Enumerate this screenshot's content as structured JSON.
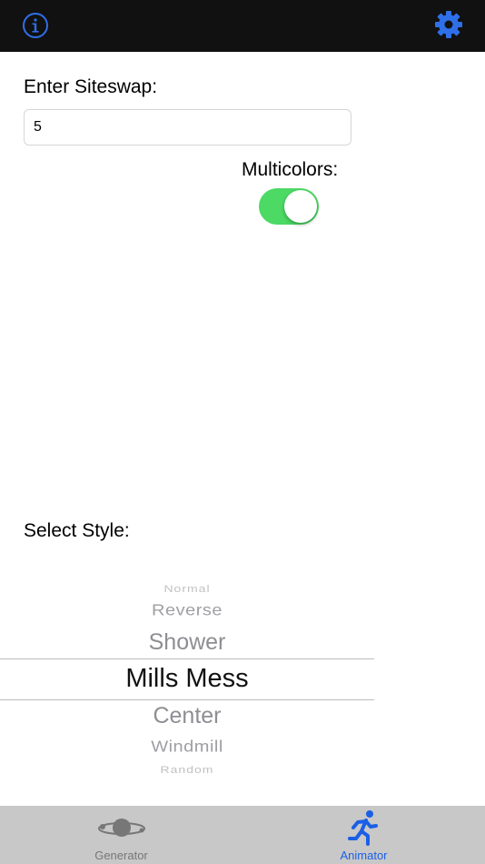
{
  "header": {
    "info_icon": "info-circle-icon",
    "settings_icon": "gear-icon",
    "accent_color": "#2f6fe8"
  },
  "form": {
    "siteswap_label": "Enter Siteswap:",
    "siteswap_value": "5",
    "multicolor_label": "Multicolors:",
    "multicolor_on": true,
    "toggle_color": "#4cd964"
  },
  "style_picker": {
    "label": "Select Style:",
    "options": [
      "Normal",
      "Reverse",
      "Shower",
      "Mills Mess",
      "Center",
      "Windmill",
      "Random"
    ],
    "selected": "Mills Mess"
  },
  "tabbar": {
    "tabs": [
      {
        "label": "Generator",
        "icon": "planet-orbit-icon",
        "active": false,
        "color": "#777777"
      },
      {
        "label": "Animator",
        "icon": "running-person-icon",
        "active": true,
        "color": "#1a5fe6"
      }
    ]
  }
}
